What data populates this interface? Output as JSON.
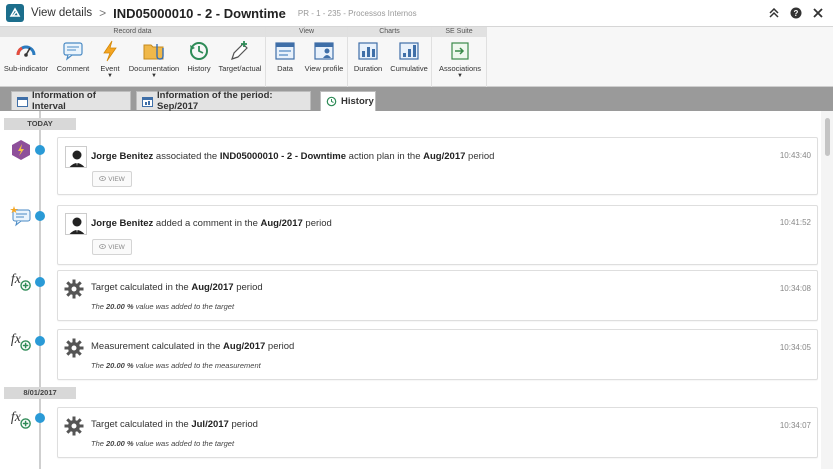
{
  "header": {
    "view_label": "View details",
    "separator": ">",
    "title": "IND05000010 - 2 - Downtime",
    "subtitle": "PR - 1 - 235 - Processos Internos"
  },
  "ribbon": {
    "groups": {
      "record_data": "Record data",
      "view": "View",
      "charts": "Charts",
      "se_suite": "SE Suite"
    },
    "buttons": {
      "sub_indicator": "Sub-indicator",
      "comment": "Comment",
      "event": "Event",
      "documentation": "Documentation",
      "history": "History",
      "target_actual": "Target/actual",
      "data": "Data",
      "view_profile": "View profile",
      "duration": "Duration",
      "cumulative": "Cumulative",
      "associations": "Associations"
    }
  },
  "tabs": {
    "interval": "Information of Interval",
    "period": "Information of the period: Sep/2017",
    "history": "History"
  },
  "timeline": {
    "today_label": "TODAY",
    "date2_label": "8/01/2017",
    "view_label": "VIEW",
    "e1": {
      "user": "Jorge Benitez",
      "t1": " associated the ",
      "plan": "IND05000010 - 2 - Downtime",
      "t2": " action plan in the ",
      "period": "Aug/2017",
      "t3": " period",
      "time": "10:43:40"
    },
    "e2": {
      "user": "Jorge Benitez",
      "t1": " added a comment in the ",
      "period": "Aug/2017",
      "t2": " period",
      "time": "10:41:52"
    },
    "e3": {
      "t1": "Target calculated in the ",
      "period": "Aug/2017",
      "t2": " period",
      "time": "10:34:08",
      "d1": "The ",
      "value": "20.00 %",
      "d2": " value was added to the target"
    },
    "e4": {
      "t1": "Measurement calculated in the ",
      "period": "Aug/2017",
      "t2": " period",
      "time": "10:34:05",
      "d1": "The ",
      "value": "20.00 %",
      "d2": " value was added to the measurement"
    },
    "e5": {
      "t1": "Target calculated in the ",
      "period": "Jul/2017",
      "t2": " period",
      "time": "10:34:07",
      "d1": "The ",
      "value": "20.00 %",
      "d2": " value was added to the target"
    }
  },
  "colors": {
    "accent": "#2a9ad6",
    "logo": "#1c6e8c",
    "event_hex": "#8e4f9a",
    "tabs_bg": "#9a9a9a"
  }
}
